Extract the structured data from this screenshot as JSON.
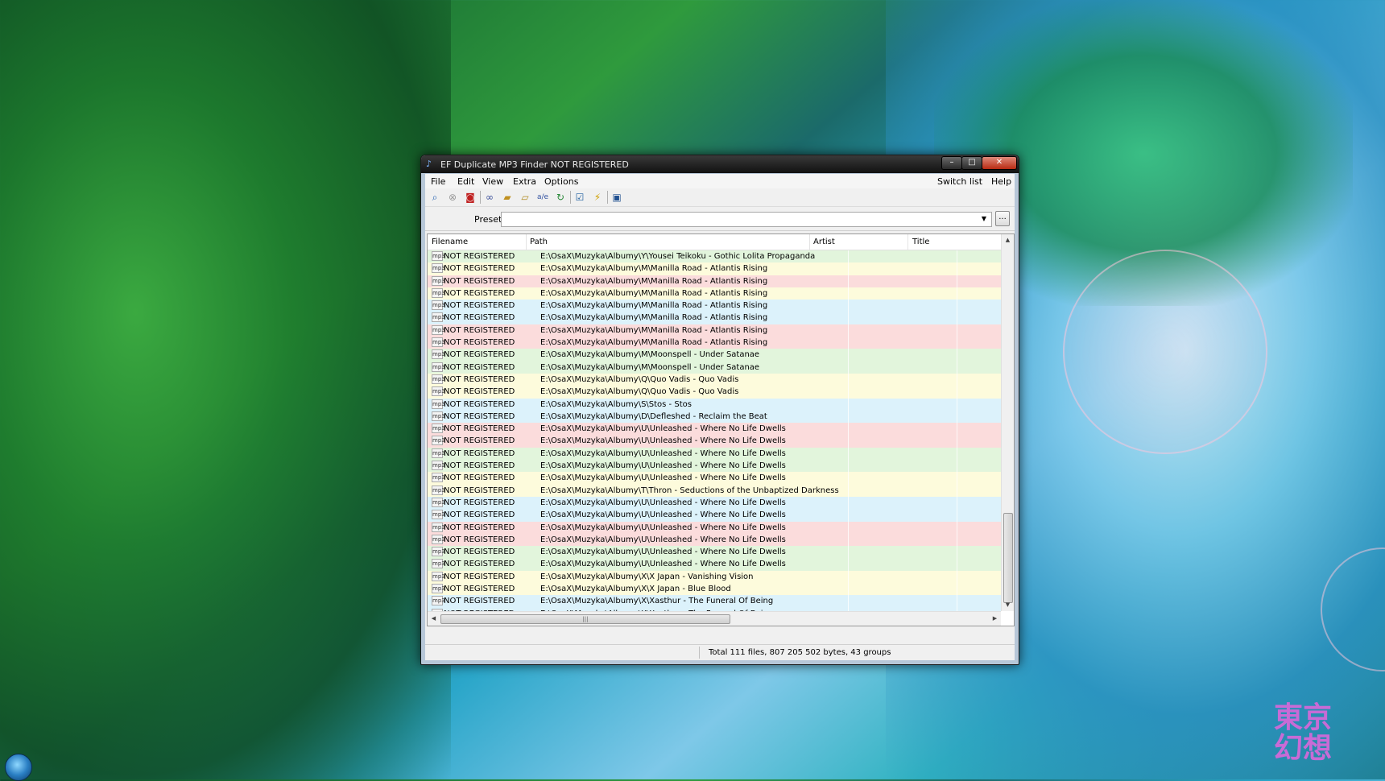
{
  "window": {
    "title": "EF Duplicate MP3 Finder NOT REGISTERED",
    "min_glyph": "–",
    "max_glyph": "□",
    "close_glyph": "✕"
  },
  "menu": {
    "file": "File",
    "edit": "Edit",
    "view": "View",
    "extra": "Extra",
    "options": "Options",
    "switch_list": "Switch list",
    "help": "Help"
  },
  "toolbar": {
    "icons": [
      "search-icon",
      "stop-icon",
      "record-icon",
      "binoculars-icon",
      "open-folder-icon",
      "export-folder-icon",
      "rename-icon",
      "refresh-icon",
      "checklist-icon",
      "lightning-icon",
      "clipboard-icon"
    ]
  },
  "preset": {
    "label": "Preset",
    "value": "",
    "browse": "..."
  },
  "columns": {
    "filename": "Filename",
    "path": "Path",
    "artist": "Artist",
    "title": "Title"
  },
  "rows": [
    {
      "mp3": "mp3",
      "filename": "NOT REGISTERED",
      "path": "E:\\OsaX\\Muzyka\\Albumy\\Y\\Yousei Teikoku - Gothic Lolita Propaganda",
      "group": "g"
    },
    {
      "mp3": "mp3",
      "filename": "NOT REGISTERED",
      "path": "E:\\OsaX\\Muzyka\\Albumy\\M\\Manilla Road - Atlantis Rising",
      "group": "y"
    },
    {
      "mp3": "mp3",
      "filename": "NOT REGISTERED",
      "path": "E:\\OsaX\\Muzyka\\Albumy\\M\\Manilla Road - Atlantis Rising",
      "group": "r"
    },
    {
      "mp3": "mp3",
      "filename": "NOT REGISTERED",
      "path": "E:\\OsaX\\Muzyka\\Albumy\\M\\Manilla Road - Atlantis Rising",
      "group": "y"
    },
    {
      "mp3": "mp3",
      "filename": "NOT REGISTERED",
      "path": "E:\\OsaX\\Muzyka\\Albumy\\M\\Manilla Road - Atlantis Rising",
      "group": "b"
    },
    {
      "mp3": "mp3",
      "filename": "NOT REGISTERED",
      "path": "E:\\OsaX\\Muzyka\\Albumy\\M\\Manilla Road - Atlantis Rising",
      "group": "b"
    },
    {
      "mp3": "mp3",
      "filename": "NOT REGISTERED",
      "path": "E:\\OsaX\\Muzyka\\Albumy\\M\\Manilla Road - Atlantis Rising",
      "group": "r"
    },
    {
      "mp3": "mp3",
      "filename": "NOT REGISTERED",
      "path": "E:\\OsaX\\Muzyka\\Albumy\\M\\Manilla Road - Atlantis Rising",
      "group": "r"
    },
    {
      "mp3": "mp3",
      "filename": "NOT REGISTERED",
      "path": "E:\\OsaX\\Muzyka\\Albumy\\M\\Moonspell - Under Satanae",
      "group": "g"
    },
    {
      "mp3": "mp3",
      "filename": "NOT REGISTERED",
      "path": "E:\\OsaX\\Muzyka\\Albumy\\M\\Moonspell - Under Satanae",
      "group": "g"
    },
    {
      "mp3": "mp3",
      "filename": "NOT REGISTERED",
      "path": "E:\\OsaX\\Muzyka\\Albumy\\Q\\Quo Vadis - Quo Vadis",
      "group": "y"
    },
    {
      "mp3": "mp3",
      "filename": "NOT REGISTERED",
      "path": "E:\\OsaX\\Muzyka\\Albumy\\Q\\Quo Vadis - Quo Vadis",
      "group": "y"
    },
    {
      "mp3": "mp3",
      "filename": "NOT REGISTERED",
      "path": "E:\\OsaX\\Muzyka\\Albumy\\S\\Stos - Stos",
      "group": "b"
    },
    {
      "mp3": "mp3",
      "filename": "NOT REGISTERED",
      "path": "E:\\OsaX\\Muzyka\\Albumy\\D\\Defleshed - Reclaim the Beat",
      "group": "b"
    },
    {
      "mp3": "mp3",
      "filename": "NOT REGISTERED",
      "path": "E:\\OsaX\\Muzyka\\Albumy\\U\\Unleashed - Where No Life Dwells",
      "group": "r"
    },
    {
      "mp3": "mp3",
      "filename": "NOT REGISTERED",
      "path": "E:\\OsaX\\Muzyka\\Albumy\\U\\Unleashed - Where No Life Dwells",
      "group": "r"
    },
    {
      "mp3": "mp3",
      "filename": "NOT REGISTERED",
      "path": "E:\\OsaX\\Muzyka\\Albumy\\U\\Unleashed - Where No Life Dwells",
      "group": "g"
    },
    {
      "mp3": "mp3",
      "filename": "NOT REGISTERED",
      "path": "E:\\OsaX\\Muzyka\\Albumy\\U\\Unleashed - Where No Life Dwells",
      "group": "g"
    },
    {
      "mp3": "mp3",
      "filename": "NOT REGISTERED",
      "path": "E:\\OsaX\\Muzyka\\Albumy\\U\\Unleashed - Where No Life Dwells",
      "group": "y"
    },
    {
      "mp3": "mp3",
      "filename": "NOT REGISTERED",
      "path": "E:\\OsaX\\Muzyka\\Albumy\\T\\Thron - Seductions of the Unbaptized Darkness",
      "group": "y"
    },
    {
      "mp3": "mp3",
      "filename": "NOT REGISTERED",
      "path": "E:\\OsaX\\Muzyka\\Albumy\\U\\Unleashed - Where No Life Dwells",
      "group": "b"
    },
    {
      "mp3": "mp3",
      "filename": "NOT REGISTERED",
      "path": "E:\\OsaX\\Muzyka\\Albumy\\U\\Unleashed - Where No Life Dwells",
      "group": "b"
    },
    {
      "mp3": "mp3",
      "filename": "NOT REGISTERED",
      "path": "E:\\OsaX\\Muzyka\\Albumy\\U\\Unleashed - Where No Life Dwells",
      "group": "r"
    },
    {
      "mp3": "mp3",
      "filename": "NOT REGISTERED",
      "path": "E:\\OsaX\\Muzyka\\Albumy\\U\\Unleashed - Where No Life Dwells",
      "group": "r"
    },
    {
      "mp3": "mp3",
      "filename": "NOT REGISTERED",
      "path": "E:\\OsaX\\Muzyka\\Albumy\\U\\Unleashed - Where No Life Dwells",
      "group": "g"
    },
    {
      "mp3": "mp3",
      "filename": "NOT REGISTERED",
      "path": "E:\\OsaX\\Muzyka\\Albumy\\U\\Unleashed - Where No Life Dwells",
      "group": "g"
    },
    {
      "mp3": "mp3",
      "filename": "NOT REGISTERED",
      "path": "E:\\OsaX\\Muzyka\\Albumy\\X\\X Japan - Vanishing Vision",
      "group": "y"
    },
    {
      "mp3": "mp3",
      "filename": "NOT REGISTERED",
      "path": "E:\\OsaX\\Muzyka\\Albumy\\X\\X Japan - Blue Blood",
      "group": "y"
    },
    {
      "mp3": "mp3",
      "filename": "NOT REGISTERED",
      "path": "E:\\OsaX\\Muzyka\\Albumy\\X\\Xasthur - The Funeral Of Being",
      "group": "b"
    },
    {
      "mp3": "mp3",
      "filename": "NOT REGISTERED",
      "path": "E:\\OsaX\\Muzyka\\Albumy\\X\\Xasthur - The Funeral Of Being",
      "group": "b"
    }
  ],
  "status": {
    "text": "Total 111 files, 807 205 502 bytes, 43 groups"
  },
  "desktop": {
    "logo_text": "東京幻想"
  },
  "colors": {
    "group_green": "#e2f5dc",
    "group_red": "#fbdcdc",
    "group_yellow": "#fdfbdc",
    "group_blue": "#dcf2fb"
  }
}
